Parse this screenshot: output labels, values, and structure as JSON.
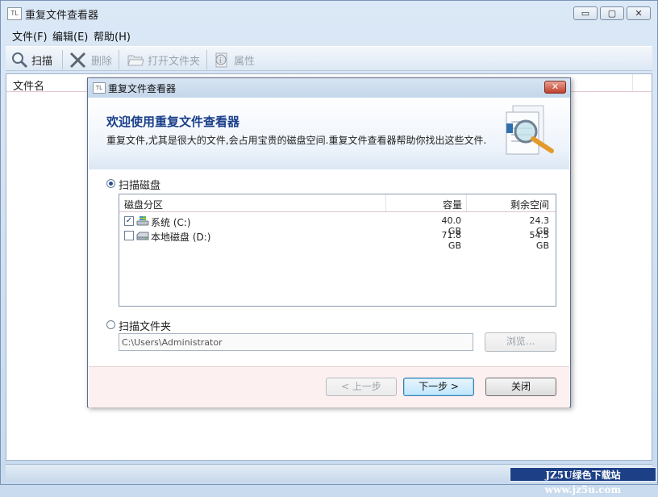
{
  "window": {
    "title": "重复文件查看器",
    "icon_text": "TL",
    "min_glyph": "▭",
    "max_glyph": "▢",
    "close_glyph": "✕"
  },
  "menu": [
    "文件(F)",
    "编辑(E)",
    "帮助(H)"
  ],
  "toolbar": {
    "scan": "扫描",
    "delete": "删除",
    "open_folder": "打开文件夹",
    "properties": "属性"
  },
  "list": {
    "column_filename": "文件名"
  },
  "watermark": "JZ5U绿色下载站www.jz5u.com",
  "dialog": {
    "title": "重复文件查看器",
    "icon_text": "TL",
    "close_glyph": "✕",
    "banner_title": "欢迎使用重复文件查看器",
    "banner_desc": "重复文件,尤其是很大的文件,会占用宝贵的磁盘空间.重复文件查看器帮助你找出这些文件.",
    "scan_disk_label": "扫描磁盘",
    "scan_disk_selected": true,
    "columns": {
      "partition": "磁盘分区",
      "capacity": "容量",
      "free": "剩余空间"
    },
    "drives": [
      {
        "label": "系统 (C:)",
        "checked": true,
        "checkmark": "✓",
        "capacity": "40.0 GB",
        "free": "24.3 GB"
      },
      {
        "label": "本地磁盘 (D:)",
        "checked": false,
        "checkmark": "",
        "capacity": "71.8 GB",
        "free": "54.5 GB"
      }
    ],
    "scan_folder_label": "扫描文件夹",
    "folder_path": "C:\\Users\\Administrator",
    "browse": "浏览...",
    "back": "< 上一步",
    "next": "下一步 >",
    "close": "关闭"
  },
  "colors": {
    "accent_title": "#1a3f8a",
    "footer_bg": "#fdf0f0",
    "watermark_bg": "#1c3f86"
  }
}
